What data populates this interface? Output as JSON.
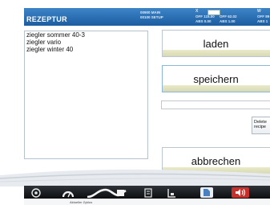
{
  "header": {
    "title": "REZEPTUR",
    "machine_lines": [
      "00900 MAIN",
      "00100 SETUP"
    ],
    "axis_x": {
      "label": "X",
      "off": "OFF 115.00",
      "off2": "OFF 62.02",
      "abs": "ABS 0.00",
      "abs2": "ABS 1.00"
    },
    "axis_w": {
      "label": "W",
      "off": "OFF 89",
      "abs": "ABS 1"
    }
  },
  "recipe_list": {
    "items": [
      "ziegler sommer 40-3",
      "ziegler vario",
      "ziegler winter 40"
    ]
  },
  "buttons": {
    "load": "laden",
    "save": "speichern",
    "cancel": "abbrechen",
    "delete": "Delete\nrecipe"
  },
  "recipe_name_input": {
    "value": ""
  },
  "taskbar": {
    "icons": [
      "help-icon",
      "gauge-icon",
      "graphic-icon",
      "document-icon",
      "chart-icon",
      "file-icon",
      "sound-icon"
    ],
    "tooltip": "Aktueller Zyklus"
  },
  "colors": {
    "header": "#2a6fb4",
    "button_stripe": "#dcdcb8",
    "sound_button": "#c8312b"
  }
}
